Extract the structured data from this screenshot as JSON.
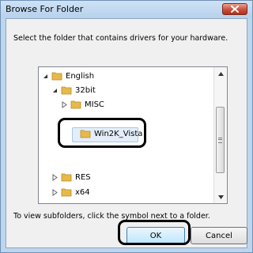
{
  "window": {
    "title": "Browse For Folder"
  },
  "instruction": "Select the folder that contains drivers for your hardware.",
  "tree": {
    "items": [
      {
        "label": "English",
        "expander": "expanded",
        "level": 0
      },
      {
        "label": "32bit",
        "expander": "expanded",
        "level": 1
      },
      {
        "label": "MISC",
        "expander": "collapsed",
        "level": 2
      },
      {
        "label": "Win2K_Vista",
        "expander": "none",
        "level": 2,
        "selected": true
      },
      {
        "label": "RES",
        "expander": "collapsed",
        "level": 1
      },
      {
        "label": "x64",
        "expander": "collapsed",
        "level": 1
      }
    ]
  },
  "hint": "To view subfolders, click the symbol next to a folder.",
  "buttons": {
    "ok": "OK",
    "cancel": "Cancel"
  },
  "colors": {
    "folder": "#e8b94a",
    "annotation_ring": "#000000",
    "selection": "#e3eef9"
  }
}
